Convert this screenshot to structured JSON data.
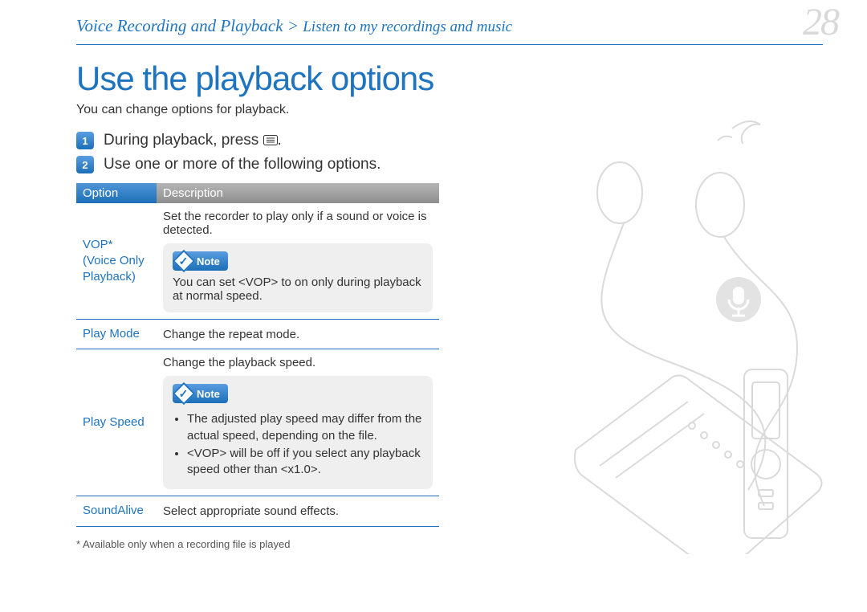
{
  "breadcrumb": {
    "main": "Voice Recording and Playback",
    "separator": ">",
    "sub": "Listen to my recordings and music"
  },
  "page_number": "28",
  "section_title": "Use the playback options",
  "intro": "You can change options for playback.",
  "steps": [
    {
      "num": "1",
      "text_before": "During playback, press ",
      "text_after": "."
    },
    {
      "num": "2",
      "text_before": "Use one or more of the following options.",
      "text_after": ""
    }
  ],
  "table": {
    "headers": {
      "option": "Option",
      "description": "Description"
    },
    "rows": [
      {
        "option": "VOP*\n(Voice Only Playback)",
        "desc_top": "Set the recorder to play only if a sound or voice is detected.",
        "note": "You can set <VOP> to on only during playback at normal speed."
      },
      {
        "option": "Play Mode",
        "desc_top": "Change the repeat mode."
      },
      {
        "option": "Play Speed",
        "desc_top": "Change the playback speed.",
        "note_list": [
          "The adjusted play speed may differ from the actual speed, depending on the file.",
          "<VOP> will be off if you select any playback speed other than <x1.0>."
        ]
      },
      {
        "option": "SoundAlive",
        "desc_top": "Select appropriate sound effects."
      }
    ]
  },
  "note_label": "Note",
  "footnote": "* Available only when a recording file is played"
}
